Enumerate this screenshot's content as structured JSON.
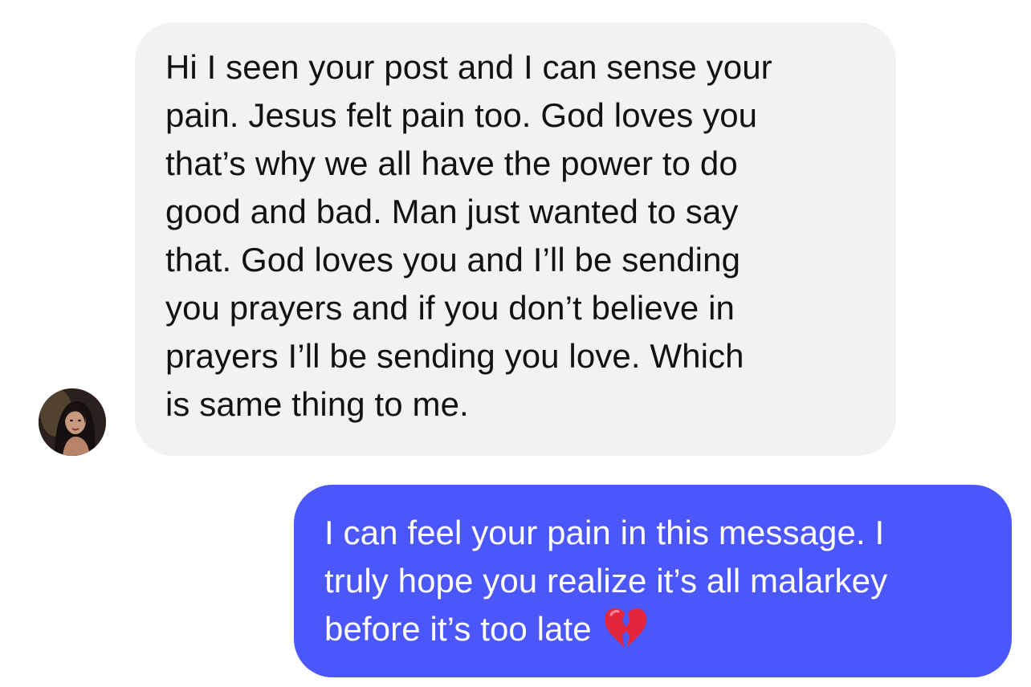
{
  "conversation": {
    "incoming": {
      "lines": [
        "Hi I seen your post and I can sense your",
        "pain. Jesus felt pain too. God loves you",
        "that’s why we all have the power to do",
        "good and bad. Man just wanted to say",
        "that. God loves you and I’ll be sending",
        "you prayers and if you don’t believe in",
        "prayers I’ll be sending you love. Which",
        "is same thing to me."
      ],
      "bubble_color": "#f1f2f4",
      "text_color": "#121212"
    },
    "outgoing": {
      "lines": [
        "I can feel your pain in this message. I",
        "truly hope you realize it’s all malarkey",
        "before it’s too late"
      ],
      "emoji": "broken-heart-icon",
      "bubble_color": "#4b57fb",
      "text_color": "#ffffff"
    },
    "avatar": "contact-avatar"
  }
}
